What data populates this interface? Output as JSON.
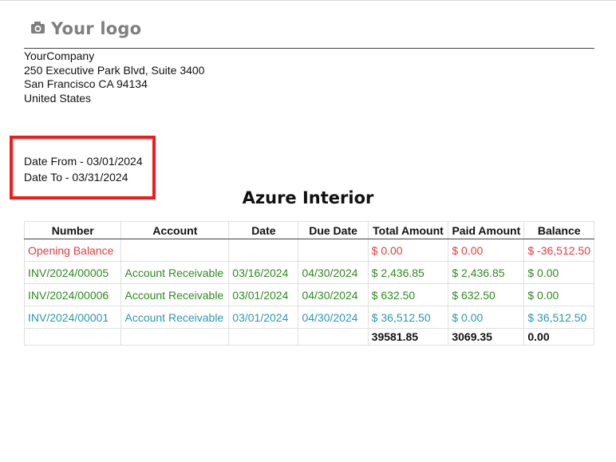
{
  "header": {
    "logo_text": "Your logo",
    "company": {
      "name": "YourCompany",
      "street": "250 Executive Park Blvd, Suite 3400",
      "city_line": "San Francisco CA 94134",
      "country": "United States"
    }
  },
  "filters": {
    "date_from": "Date From - 03/01/2024",
    "date_to": "Date To - 03/31/2024"
  },
  "report": {
    "partner": "Azure Interior",
    "columns": [
      "Number",
      "Account",
      "Date",
      "Due Date",
      "Total Amount",
      "Paid Amount",
      "Balance"
    ],
    "rows": [
      {
        "number": "Opening Balance",
        "account": "",
        "date": "",
        "due_date": "",
        "total": "$ 0.00",
        "paid": "$ 0.00",
        "balance": "$ -36,512.50",
        "color": "#e53b3b"
      },
      {
        "number": "INV/2024/00005",
        "account": "Account Receivable",
        "date": "03/16/2024",
        "due_date": "04/30/2024",
        "total": "$ 2,436.85",
        "paid": "$ 2,436.85",
        "balance": "$ 0.00",
        "color": "#2f8a1f"
      },
      {
        "number": "INV/2024/00006",
        "account": "Account Receivable",
        "date": "03/01/2024",
        "due_date": "04/30/2024",
        "total": "$ 632.50",
        "paid": "$ 632.50",
        "balance": "$ 0.00",
        "color": "#2f8a1f"
      },
      {
        "number": "INV/2024/00001",
        "account": "Account Receivable",
        "date": "03/01/2024",
        "due_date": "04/30/2024",
        "total": "$ 36,512.50",
        "paid": "$ 0.00",
        "balance": "$ 36,512.50",
        "color": "#2a97b3"
      }
    ],
    "totals": {
      "total": "39581.85",
      "paid": "3069.35",
      "balance": "0.00"
    }
  },
  "colors": {
    "opening_balance": "#e53b3b",
    "paid_invoice": "#2f8a1f",
    "open_invoice": "#2a97b3",
    "highlight_box": "#ee1c1c"
  },
  "icons": {
    "logo": "camera-icon"
  }
}
